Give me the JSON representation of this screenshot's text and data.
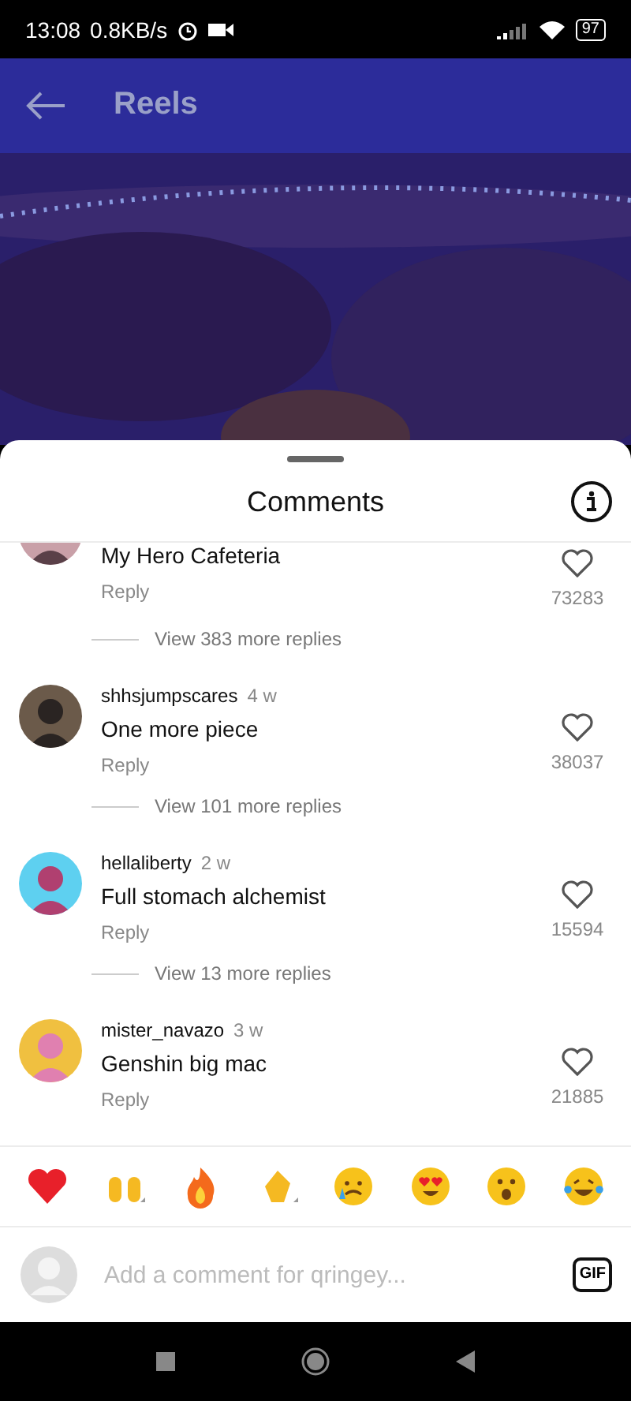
{
  "status_bar": {
    "time": "13:08",
    "speed": "0.8KB/s",
    "battery": "97"
  },
  "header": {
    "title": "Reels"
  },
  "sheet": {
    "title": "Comments"
  },
  "comments": [
    {
      "text": "My Hero Cafeteria",
      "reply": "Reply",
      "likes": "73283",
      "view_replies": "View 383 more replies",
      "liked": false
    },
    {
      "username": "shhsjumpscares",
      "time": "4 w",
      "text": "One more piece",
      "reply": "Reply",
      "likes": "38037",
      "view_replies": "View 101 more replies",
      "liked": false
    },
    {
      "username": "hellaliberty",
      "time": "2 w",
      "text": "Full stomach alchemist",
      "reply": "Reply",
      "likes": "15594",
      "view_replies": "View 13 more replies",
      "liked": false
    },
    {
      "username": "mister_navazo",
      "time": "3 w",
      "text": "Genshin big mac",
      "reply": "Reply",
      "likes": "21885",
      "liked": false
    }
  ],
  "reactions": [
    {
      "kind": "heart"
    },
    {
      "kind": "raised-hands"
    },
    {
      "kind": "fire"
    },
    {
      "kind": "clap"
    },
    {
      "kind": "crying"
    },
    {
      "kind": "heart-eyes"
    },
    {
      "kind": "surprised"
    },
    {
      "kind": "laughing"
    }
  ],
  "composer": {
    "placeholder": "Add a comment for qringey...",
    "gif": "GIF"
  }
}
